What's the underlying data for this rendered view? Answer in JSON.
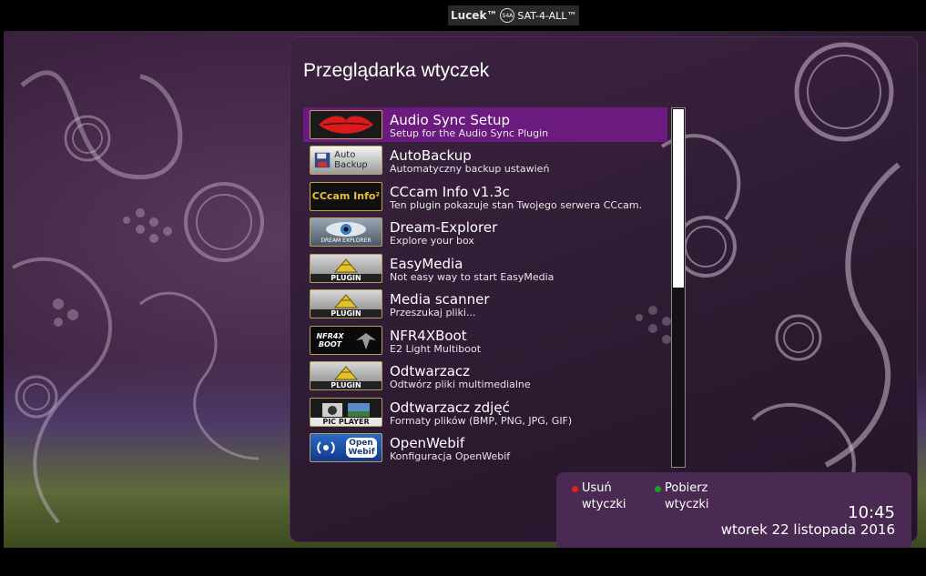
{
  "topbar": {
    "brand": "Lucek™",
    "channel": "SAT-4-ALL™",
    "logo_text": "S4A"
  },
  "screen": {
    "title": "Przeglądarka wtyczek"
  },
  "plugins": [
    {
      "name": "Audio Sync Setup",
      "desc": "Setup for the Audio Sync Plugin",
      "icon": "lips-icon",
      "selected": true
    },
    {
      "name": "AutoBackup",
      "desc": "Automatyczny backup ustawień",
      "icon": "autobackup-icon",
      "icon_text": "Auto Backup"
    },
    {
      "name": "CCcam Info v1.3c",
      "desc": "Ten plugin pokazuje stan Twojego serwera CCcam.",
      "icon": "cccam-icon",
      "icon_text": "CCcam Info²"
    },
    {
      "name": "Dream-Explorer",
      "desc": "Explore your box",
      "icon": "eye-icon",
      "icon_text": "DREAM EXPLORER"
    },
    {
      "name": "EasyMedia",
      "desc": "Not easy way to start EasyMedia",
      "icon": "plugin-icon",
      "icon_text": "PLUGIN"
    },
    {
      "name": "Media scanner",
      "desc": "Przeszukaj pliki...",
      "icon": "plugin-icon",
      "icon_text": "PLUGIN"
    },
    {
      "name": "NFR4XBoot",
      "desc": "E2 Light Multiboot",
      "icon": "nfr4xboot-icon",
      "icon_text": "NFR4X BOOT"
    },
    {
      "name": "Odtwarzacz",
      "desc": "Odtwórz pliki multimedialne",
      "icon": "plugin-icon",
      "icon_text": "PLUGIN"
    },
    {
      "name": "Odtwarzacz zdjęć",
      "desc": "Formaty plików (BMP, PNG, JPG, GIF)",
      "icon": "picplayer-icon",
      "icon_text": "PIC PLAYER"
    },
    {
      "name": "OpenWebif",
      "desc": "Konfiguracja OpenWebif",
      "icon": "openwebif-icon",
      "icon_text": "Open Webif"
    }
  ],
  "scrollbar": {
    "position_fraction": 0.0,
    "visible_fraction": 0.5
  },
  "footer": {
    "red_key_line1": "Usuń",
    "red_key_line2": "wtyczki",
    "green_key_line1": "Pobierz",
    "green_key_line2": "wtyczki",
    "time": "10:45",
    "date": "wtorek 22 listopada 2016"
  },
  "colors": {
    "selected_row": "#6b1a7e",
    "red_key": "#e02020",
    "green_key": "#20a020",
    "panel": "#2d1a31"
  }
}
